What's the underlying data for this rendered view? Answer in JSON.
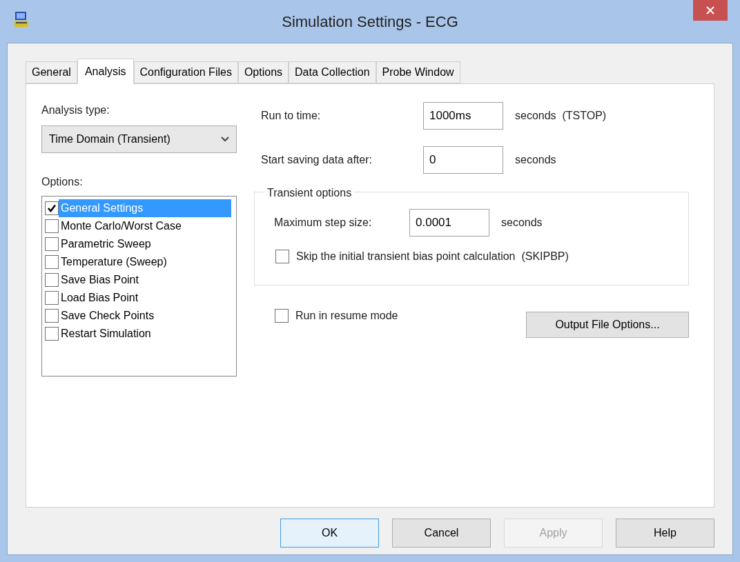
{
  "window": {
    "title": "Simulation Settings - ECG"
  },
  "tabs": [
    {
      "label": "General",
      "selected": false
    },
    {
      "label": "Analysis",
      "selected": true
    },
    {
      "label": "Configuration Files",
      "selected": false
    },
    {
      "label": "Options",
      "selected": false
    },
    {
      "label": "Data Collection",
      "selected": false
    },
    {
      "label": "Probe Window",
      "selected": false
    }
  ],
  "analysis_type": {
    "label": "Analysis type:",
    "value": "Time Domain (Transient)"
  },
  "options": {
    "label": "Options:",
    "items": [
      {
        "label": "General Settings",
        "checked": true,
        "selected": true
      },
      {
        "label": "Monte Carlo/Worst Case",
        "checked": false,
        "selected": false
      },
      {
        "label": "Parametric Sweep",
        "checked": false,
        "selected": false
      },
      {
        "label": "Temperature (Sweep)",
        "checked": false,
        "selected": false
      },
      {
        "label": "Save Bias Point",
        "checked": false,
        "selected": false
      },
      {
        "label": "Load Bias Point",
        "checked": false,
        "selected": false
      },
      {
        "label": "Save Check Points",
        "checked": false,
        "selected": false
      },
      {
        "label": "Restart Simulation",
        "checked": false,
        "selected": false
      }
    ]
  },
  "run_to_time": {
    "label": "Run to time:",
    "value": "1000ms",
    "unit": "seconds  (TSTOP)"
  },
  "start_saving": {
    "label": "Start saving data after:",
    "value": "0",
    "unit": "seconds"
  },
  "transient_options": {
    "title": "Transient options",
    "max_step": {
      "label": "Maximum step size:",
      "value": "0.0001",
      "unit": "seconds"
    },
    "skip_bias": {
      "label": "Skip the initial transient bias point calculation  (SKIPBP)",
      "checked": false
    }
  },
  "resume_mode": {
    "label": "Run in resume mode",
    "checked": false
  },
  "output_file_button": "Output File Options...",
  "buttons": [
    {
      "label": "OK",
      "default": true,
      "disabled": false
    },
    {
      "label": "Cancel",
      "default": false,
      "disabled": false
    },
    {
      "label": "Apply",
      "default": false,
      "disabled": true
    },
    {
      "label": "Help",
      "default": false,
      "disabled": false
    }
  ]
}
